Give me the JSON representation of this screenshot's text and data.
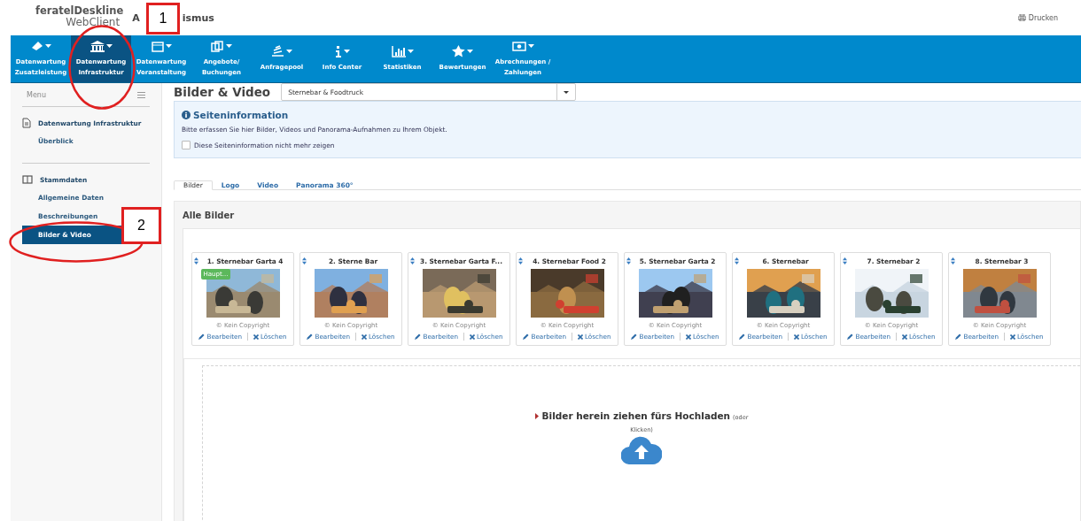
{
  "header": {
    "logo_top": "feratelDeskline",
    "logo_bottom": "WebClient",
    "title_start": "A",
    "title_end": "ismus",
    "print": "Drucken"
  },
  "nav": [
    {
      "label": "Datenwartung Zusatzleistung",
      "selected": false
    },
    {
      "label": "Datenwartung Infrastruktur",
      "selected": true
    },
    {
      "label": "Datenwartung Veranstaltung",
      "selected": false
    },
    {
      "label": "Angebote/ Buchungen",
      "selected": false
    },
    {
      "label": "Anfragepool",
      "selected": false
    },
    {
      "label": "Info Center",
      "selected": false
    },
    {
      "label": "Statistiken",
      "selected": false
    },
    {
      "label": "Bewertungen",
      "selected": false
    },
    {
      "label": "Abrechnungen / Zahlungen",
      "selected": false
    }
  ],
  "sidebar": {
    "title": "Menu",
    "sections": [
      {
        "title": "Datenwartung Infrastruktur",
        "items": [
          {
            "label": "Überblick",
            "selected": false
          }
        ]
      },
      {
        "title": "Stammdaten",
        "items": [
          {
            "label": "Allgemeine Daten",
            "selected": false
          },
          {
            "label": "Beschreibungen",
            "selected": false
          },
          {
            "label": "Bilder & Video",
            "selected": true
          }
        ]
      }
    ]
  },
  "page": {
    "title": "Bilder & Video",
    "select_value": "Sternebar & Foodtruck",
    "info": {
      "title": "Seiteninformation",
      "text": "Bitte erfassen Sie hier Bilder, Videos und Panorama-Aufnahmen zu Ihrem Objekt.",
      "checkbox_label": "Diese Seiteninformation nicht mehr zeigen",
      "checked": false
    },
    "tabs": [
      {
        "label": "Bilder",
        "selected": true
      },
      {
        "label": "Logo",
        "selected": false
      },
      {
        "label": "Video",
        "selected": false
      },
      {
        "label": "Panorama 360°",
        "selected": false
      }
    ],
    "panel_title": "Alle Bilder",
    "images": [
      {
        "title": "1. Sternebar Garta 4",
        "badge": "Haupt...",
        "copyright": "© Kein Copyright",
        "edit": "Bearbeiten",
        "delete": "Löschen",
        "kind": "picture"
      },
      {
        "title": "2. Sterne Bar",
        "copyright": "© Kein Copyright",
        "edit": "Bearbeiten",
        "delete": "Löschen",
        "kind": "picture"
      },
      {
        "title": "3. Sternebar Garta F...",
        "copyright": "© Kein Copyright",
        "edit": "Bearbeiten",
        "delete": "Löschen",
        "kind": "picture"
      },
      {
        "title": "4. Sternebar Food 2",
        "copyright": "© Kein Copyright",
        "edit": "Bearbeiten",
        "delete": "Löschen",
        "kind": "picture"
      },
      {
        "title": "5. Sternebar Garta 2",
        "copyright": "© Kein Copyright",
        "edit": "Bearbeiten",
        "delete": "Löschen",
        "kind": "picture"
      },
      {
        "title": "6. Sternebar",
        "copyright": "© Kein Copyright",
        "edit": "Bearbeiten",
        "delete": "Löschen",
        "kind": "picture"
      },
      {
        "title": "7. Sternebar 2",
        "copyright": "© Kein Copyright",
        "edit": "Bearbeiten",
        "delete": "Löschen",
        "kind": "picture"
      },
      {
        "title": "8. Sternebar 3",
        "copyright": "© Kein Copyright",
        "edit": "Bearbeiten",
        "delete": "Löschen",
        "kind": "picture"
      }
    ],
    "upload": {
      "title": "Bilder herein ziehen fürs Hochladen",
      "hint_start": "(oder",
      "hint_end": "Klicken)"
    }
  },
  "annotations": [
    {
      "label": "1"
    },
    {
      "label": "2"
    }
  ]
}
